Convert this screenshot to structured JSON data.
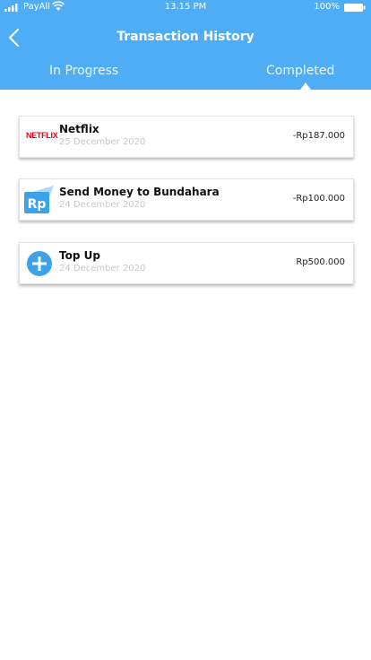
{
  "status_bar": {
    "carrier": "PayAll",
    "time": "13.15 PM",
    "battery": "100%"
  },
  "header": {
    "title": "Transaction History",
    "tabs": [
      {
        "label": "In Progress",
        "active": false
      },
      {
        "label": "Completed",
        "active": true
      }
    ]
  },
  "transactions": [
    {
      "name": "Netflix",
      "date": "25 December 2020",
      "amount": "-Rp187.000",
      "icon": "netflix-logo",
      "logo_text": "NETFLIX"
    },
    {
      "name": "Send Money to Bundahara",
      "date": "24 December 2020",
      "amount": "-Rp100.000",
      "icon": "rupiah-transfer-icon",
      "logo_text": "Rp"
    },
    {
      "name": "Top Up",
      "date": "24 December 2020",
      "amount": "Rp500.000",
      "icon": "plus-circle-icon"
    }
  ],
  "colors": {
    "header": "#4eadf4",
    "netflix": "#e50914",
    "date_text": "#c7c7c7"
  }
}
